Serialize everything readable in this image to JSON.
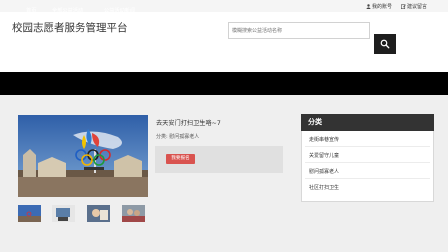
{
  "topbar": {
    "account_label": "我的账号",
    "login_label": "建议留言"
  },
  "header": {
    "site_title": "校园志愿者服务管理平台",
    "search_placeholder": "模糊搜索公益活动名称"
  },
  "nav": {
    "items": [
      {
        "label": "首页"
      },
      {
        "label": "全部公益活动"
      },
      {
        "label": "公益活动新闻"
      }
    ]
  },
  "event": {
    "title": "去天安门打扫卫生咯~7",
    "category_line": "分类: 慰问孤寡老人",
    "signup_button": "我要报名"
  },
  "sidebar": {
    "title": "分类",
    "items": [
      {
        "label": "走街串巷宣传"
      },
      {
        "label": "关爱留守儿童"
      },
      {
        "label": "慰问孤寡老人"
      },
      {
        "label": "社区打扫卫生"
      }
    ]
  },
  "colors": {
    "nav_bg": "#000000",
    "signup_button": "#d9534f",
    "sidebar_header": "#333333",
    "search_button": "#1e1e1e"
  }
}
